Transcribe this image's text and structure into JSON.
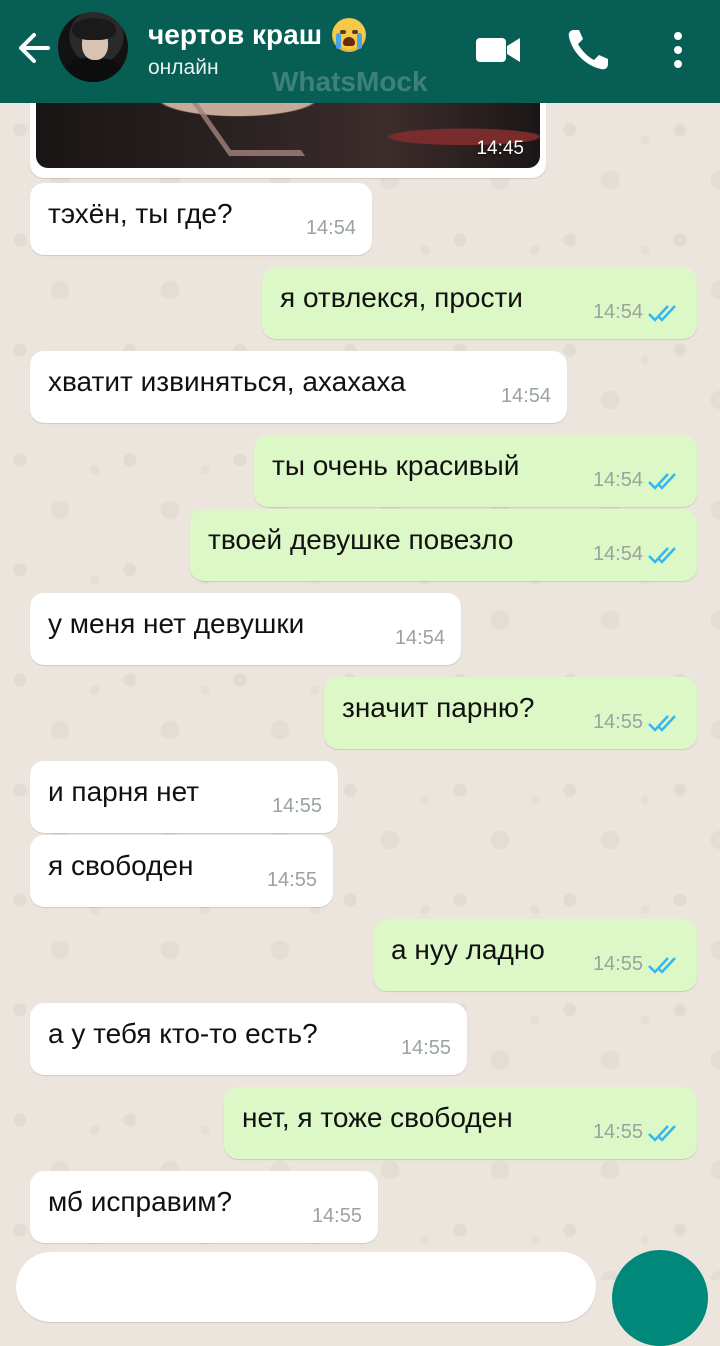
{
  "header": {
    "contact_name": "чертов краш",
    "status": "онлайн",
    "watermark": "WhatsMock"
  },
  "media": {
    "time": "14:45"
  },
  "messages": [
    {
      "direction": "in",
      "text": "тэхён, ты где?",
      "time": "14:54"
    },
    {
      "direction": "out",
      "text": "я отвлекся, прости",
      "time": "14:54",
      "read": true
    },
    {
      "direction": "in",
      "text": "хватит извиняться, ахахаха",
      "time": "14:54"
    },
    {
      "direction": "out",
      "text": "ты очень красивый",
      "time": "14:54",
      "read": true
    },
    {
      "direction": "out",
      "text": "твоей девушке повезло",
      "time": "14:54",
      "read": true
    },
    {
      "direction": "in",
      "text": "у меня нет девушки",
      "time": "14:54"
    },
    {
      "direction": "out",
      "text": "значит парню?",
      "time": "14:55",
      "read": true
    },
    {
      "direction": "in",
      "text": "и парня нет",
      "time": "14:55"
    },
    {
      "direction": "in",
      "text": "я свободен",
      "time": "14:55"
    },
    {
      "direction": "out",
      "text": "а нуу ладно",
      "time": "14:55",
      "read": true
    },
    {
      "direction": "in",
      "text": "а у тебя кто-то есть?",
      "time": "14:55"
    },
    {
      "direction": "out",
      "text": "нет, я тоже свободен",
      "time": "14:55",
      "read": true
    },
    {
      "direction": "in",
      "text": "мб исправим?",
      "time": "14:55"
    }
  ],
  "icons": {
    "back": "arrow-left-icon",
    "video": "video-camera-icon",
    "call": "phone-icon",
    "more": "more-vertical-icon",
    "emoji": "crying-face-emoji",
    "read": "double-check-icon"
  },
  "colors": {
    "header": "#075e54",
    "incoming": "#ffffff",
    "outgoing": "#dcf8c6",
    "read_ticks": "#34b7f1",
    "wallpaper": "#ece5dd",
    "send_button": "#00897b"
  }
}
